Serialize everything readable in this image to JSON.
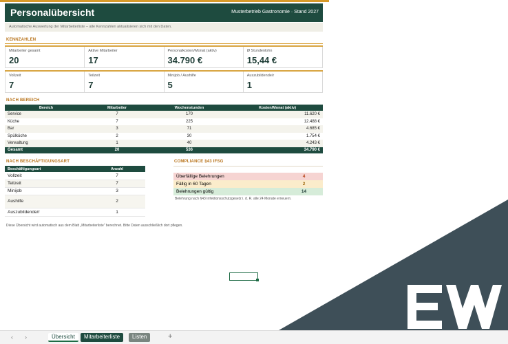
{
  "header": {
    "title": "Personalübersicht",
    "company": "Musterbetrieb Gastronomie · Stand 2027",
    "subtitle": "Automatische Auswertung der Mitarbeiterliste – alle Kennzahlen aktualisieren sich mit den Daten."
  },
  "kpi": {
    "section": "KENNZAHLEN",
    "row1": [
      {
        "label": "Mitarbeiter gesamt",
        "value": "20"
      },
      {
        "label": "Aktive Mitarbeiter",
        "value": "17"
      },
      {
        "label": "Personalkosten/Monat (aktiv)",
        "value": "34.790 €"
      },
      {
        "label": "Ø Stundenlohn",
        "value": "15,44 €"
      }
    ],
    "row2": [
      {
        "label": "Vollzeit",
        "value": "7"
      },
      {
        "label": "Teilzeit",
        "value": "7"
      },
      {
        "label": "Minijob / Aushilfe",
        "value": "5"
      },
      {
        "label": "Auszubildende/r",
        "value": "1"
      }
    ]
  },
  "areas": {
    "section": "NACH BEREICH",
    "headers": [
      "Bereich",
      "Mitarbeiter",
      "Wochenstunden",
      "Kosten/Monat (aktiv)"
    ],
    "rows": [
      [
        "Service",
        "7",
        "170",
        "11.620 €"
      ],
      [
        "Küche",
        "7",
        "225",
        "12.488 €"
      ],
      [
        "Bar",
        "3",
        "71",
        "4.685 €"
      ],
      [
        "Spülküche",
        "2",
        "30",
        "1.754 €"
      ],
      [
        "Verwaltung",
        "1",
        "40",
        "4.243 €"
      ]
    ],
    "total": [
      "Gesamt",
      "20",
      "536",
      "34.790 €"
    ]
  },
  "employment": {
    "section": "NACH BESCHÄFTIGUNGSART",
    "headers": [
      "Beschäftigungsart",
      "Anzahl"
    ],
    "rows": [
      [
        "Vollzeit",
        "7"
      ],
      [
        "Teilzeit",
        "7"
      ],
      [
        "Minijob",
        "3"
      ],
      [
        "Aushilfe",
        "2"
      ],
      [
        "Auszubildende/r",
        "1"
      ]
    ]
  },
  "compliance": {
    "section": "COMPLIANCE §43 IFSG",
    "rows": [
      {
        "label": "Überfällige Belehrungen",
        "value": "4",
        "color": "#f6d4d2"
      },
      {
        "label": "Fällig in 60 Tagen",
        "value": "2",
        "color": "#fbeccb"
      },
      {
        "label": "Belehrungen gültig",
        "value": "14",
        "color": "#d6ecd9"
      }
    ],
    "note": "Belehrung nach §43 Infektionsschutzgesetz i. d. R. alle 24 Monate erneuern."
  },
  "footer_note": "Diese Übersicht wird automatisch aus dem Blatt „Mitarbeiterliste\" berechnet. Bitte Daten ausschließlich dort pflegen.",
  "tabs": {
    "prev": "‹",
    "next": "›",
    "overview": "Übersicht",
    "employees": "Mitarbeiterliste",
    "lists": "Listen",
    "add": "+"
  },
  "colors": {
    "brand_green": "#1e4b3f",
    "accent_gold": "#d79a2a",
    "watermark": "#3e4f58"
  }
}
